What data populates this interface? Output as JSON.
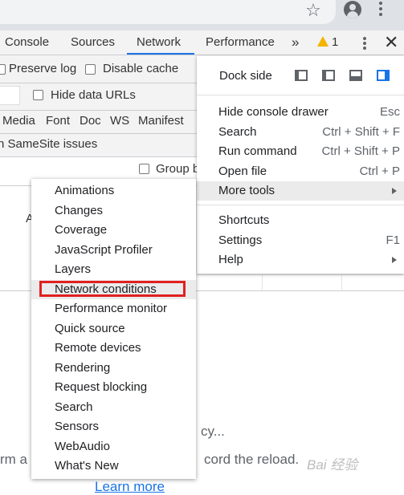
{
  "devtools": {
    "tabs": [
      "Console",
      "Sources",
      "Network",
      "Performance"
    ],
    "more_tabs": "»",
    "warning_count": "1",
    "close": "✕"
  },
  "network": {
    "preserve_log": "Preserve log",
    "disable_cache": "Disable cache",
    "hide_data_urls": "Hide data URLs",
    "filters": [
      "Media",
      "Font",
      "Doc",
      "WS",
      "Manifest"
    ],
    "samesite_text": "h SameSite issues",
    "group_label": "Group b",
    "overview_fragment": "A",
    "recording_fragment": "cy...",
    "hint_left": "rm a",
    "hint_right": "cord the reload.",
    "learn_more": "Learn more"
  },
  "menu": {
    "dock_side": "Dock side",
    "items": [
      {
        "label": "Hide console drawer",
        "shortcut": "Esc"
      },
      {
        "label": "Search",
        "shortcut": "Ctrl + Shift + F"
      },
      {
        "label": "Run command",
        "shortcut": "Ctrl + Shift + P"
      },
      {
        "label": "Open file",
        "shortcut": "Ctrl + P"
      },
      {
        "label": "More tools",
        "shortcut": ""
      }
    ],
    "items2": [
      {
        "label": "Shortcuts",
        "shortcut": ""
      },
      {
        "label": "Settings",
        "shortcut": "F1"
      },
      {
        "label": "Help",
        "shortcut": ""
      }
    ]
  },
  "submenu": {
    "items": [
      "Animations",
      "Changes",
      "Coverage",
      "JavaScript Profiler",
      "Layers",
      "Network conditions",
      "Performance monitor",
      "Quick source",
      "Remote devices",
      "Rendering",
      "Request blocking",
      "Search",
      "Sensors",
      "WebAudio",
      "What's New"
    ],
    "highlighted": "Network conditions"
  },
  "watermark": "Bai 经验",
  "colors": {
    "accent": "#1a73e8",
    "highlight_box": "#e02020",
    "warning": "#f4b400"
  }
}
